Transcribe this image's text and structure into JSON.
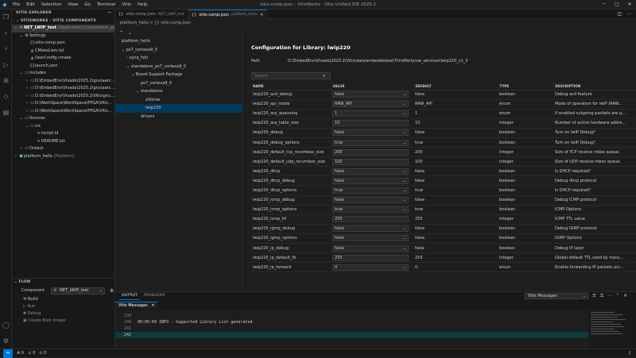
{
  "titlebar": {
    "menu": [
      "File",
      "Edit",
      "Selection",
      "View",
      "Go",
      "Terminal",
      "Vitis",
      "Help"
    ],
    "title": "vitis-comp.json - VitisWorks - Vitis Unified IDE 2025.2"
  },
  "sidebar": {
    "explorer_title": "VITIS EXPLORER",
    "components_title": "VITISWORKS - VITIS COMPONENTS",
    "component_name": "NET_LWIP_test",
    "component_desc": "[Application] [standalone_ps7_cortexa9_0]",
    "settings_label": "Settings",
    "settings_items": [
      "vitis-comp.json",
      "CMakeLists.txt",
      "UserConfig.cmake",
      "launch.json"
    ],
    "includes_label": "Includes",
    "includes_items": [
      "D:\\EmbedEnv\\Vivado\\2025.2\\gnu\\aarc...",
      "D:\\EmbedEnv\\Vivado\\2025.2\\gnu\\aarc...",
      "D:\\EmbedEnv\\Vivado\\2025.2\\Vitis\\gnu...",
      "D:\\WorkSpace\\WorkSpace\\FPGA\\Vitis...",
      "D:\\WorkSpace\\WorkSpace\\FPGA\\Vitis..."
    ],
    "sources_label": "Sources",
    "src_label": "src",
    "src_items": [
      "lscript.ld",
      "README.txt"
    ],
    "output_label": "Output",
    "platform_label": "platform_hello",
    "platform_desc": "[Platform]",
    "flow": {
      "title": "FLOW",
      "component_label": "Component",
      "component_value": "NET_LWIP_test",
      "items": [
        "Build",
        "Run",
        "Debug",
        "Create Boot Image"
      ]
    }
  },
  "editor": {
    "tabs": [
      {
        "label": "vitis-comp.json",
        "sub": "NET_LWIP_test"
      },
      {
        "label": "vitis-comp.json",
        "sub": "platform_hello"
      }
    ],
    "breadcrumb": "platform_hello  >  {} vitis-comp.json",
    "tree": [
      "platform_hello",
      "ps7_cortexa9_0",
      "zynq_fsbl",
      "standalone_ps7_cortexa9_0",
      "Board Support Package",
      "ps7_cortexa9_0",
      "standalone",
      "xiltimer",
      "lwip220",
      "drivers"
    ],
    "config_title": "Configuration for Library: lwip220",
    "path_label": "Path",
    "path_value": "D:\\EmbedEnv\\Vivado\\2025.2\\Vitis\\data\\embeddedsw\\ThirdParty\\sw_services\\lwip220_v1_3",
    "search_placeholder": "Search",
    "columns": [
      "NAME",
      "VALUE",
      "DEFAULT",
      "TYPE",
      "DESCRIPTION"
    ],
    "rows": [
      {
        "name": "lwip220_acd_debug",
        "value": "false",
        "ctl": "select",
        "default": "false",
        "type": "boolean",
        "desc": "Debug acd feature"
      },
      {
        "name": "lwip220_api_mode",
        "value": "RAW_API",
        "ctl": "select",
        "default": "RAW_API",
        "type": "enum",
        "desc": "Mode of operation for lwIP (RAW..."
      },
      {
        "name": "lwip220_arp_queueing",
        "value": "1",
        "ctl": "select",
        "default": "1",
        "type": "enum",
        "desc": "If enabled outgoing packets are q..."
      },
      {
        "name": "lwip220_arp_table_size",
        "value": "10",
        "ctl": "input",
        "default": "10",
        "type": "integer",
        "desc": "Number of active hardware addre..."
      },
      {
        "name": "lwip220_debug",
        "value": "false",
        "ctl": "select",
        "default": "false",
        "type": "boolean",
        "desc": "Turn on lwIP Debug?"
      },
      {
        "name": "lwip220_debug_options",
        "value": "true",
        "ctl": "select",
        "default": "true",
        "type": "boolean",
        "desc": "Turn on lwIP Debug?"
      },
      {
        "name": "lwip220_default_tcp_recvmbox_size",
        "value": "200",
        "ctl": "input",
        "default": "200",
        "type": "integer",
        "desc": "Size of TCP receive mbox queue."
      },
      {
        "name": "lwip220_default_udp_recvmbox_size",
        "value": "100",
        "ctl": "input",
        "default": "100",
        "type": "integer",
        "desc": "Size of UDP receive mbox queue."
      },
      {
        "name": "lwip220_dhcp",
        "value": "false",
        "ctl": "select",
        "default": "false",
        "type": "boolean",
        "desc": "Is DHCP required?"
      },
      {
        "name": "lwip220_dhcp_debug",
        "value": "false",
        "ctl": "select",
        "default": "false",
        "type": "boolean",
        "desc": "Debug dhcp protocol"
      },
      {
        "name": "lwip220_dhcp_options",
        "value": "true",
        "ctl": "select",
        "default": "true",
        "type": "boolean",
        "desc": "Is DHCP required?"
      },
      {
        "name": "lwip220_icmp_debug",
        "value": "false",
        "ctl": "select",
        "default": "false",
        "type": "boolean",
        "desc": "Debug ICMP protocol"
      },
      {
        "name": "lwip220_icmp_options",
        "value": "true",
        "ctl": "select",
        "default": "true",
        "type": "boolean",
        "desc": "ICMP Options"
      },
      {
        "name": "lwip220_icmp_ttl",
        "value": "255",
        "ctl": "input",
        "default": "255",
        "type": "integer",
        "desc": "ICMP TTL value"
      },
      {
        "name": "lwip220_igmp_debug",
        "value": "false",
        "ctl": "select",
        "default": "false",
        "type": "boolean",
        "desc": "Debug IGMP protocol"
      },
      {
        "name": "lwip220_igmp_options",
        "value": "false",
        "ctl": "select",
        "default": "false",
        "type": "boolean",
        "desc": "IGMP Options"
      },
      {
        "name": "lwip220_ip_debug",
        "value": "false",
        "ctl": "select",
        "default": "false",
        "type": "boolean",
        "desc": "Debug IP layer"
      },
      {
        "name": "lwip220_ip_default_ttl",
        "value": "255",
        "ctl": "input",
        "default": "255",
        "type": "integer",
        "desc": "Global default TTL used by trans..."
      },
      {
        "name": "lwip220_ip_forward",
        "value": "0",
        "ctl": "select",
        "default": "0",
        "type": "enum",
        "desc": "Enable forwarding IP packets acr..."
      }
    ]
  },
  "panel": {
    "tabs": [
      "OUTPUT",
      "PROBLEMS"
    ],
    "output_select": "Vitis Messages",
    "messages_tab": "Vitis Messages",
    "lines": [
      {
        "n": "239",
        "text": ""
      },
      {
        "n": "240",
        "text": "00:05:09 INFO  : Supported Library List generated."
      },
      {
        "n": "241",
        "text": ""
      },
      {
        "n": "242",
        "text": ""
      }
    ]
  },
  "status": {
    "errors": "0",
    "warnings": "0",
    "ports": "0"
  },
  "colors": {
    "accent": "#0078d4",
    "selection": "#04395e",
    "json_icon": "#e5c07b"
  }
}
